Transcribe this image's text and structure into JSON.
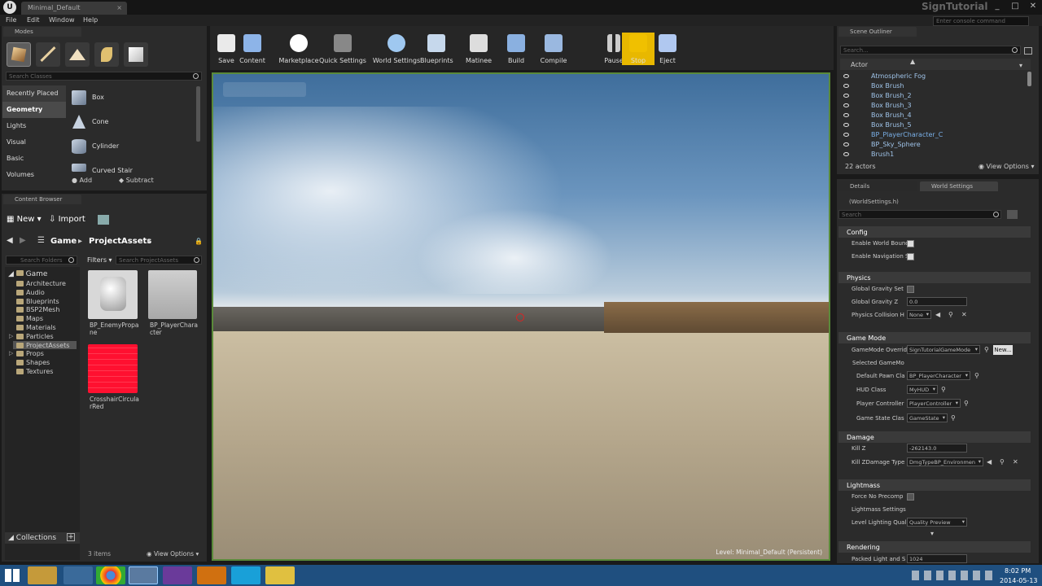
{
  "title_bar": {
    "tab": "Minimal_Default",
    "project": "SignTutorial"
  },
  "menu": [
    "File",
    "Edit",
    "Window",
    "Help"
  ],
  "console_placeholder": "Enter console command",
  "modes": {
    "tab": "Modes",
    "search_placeholder": "Search Classes",
    "categories": [
      "Recently Placed",
      "Geometry",
      "Lights",
      "Visual",
      "Basic",
      "Volumes"
    ],
    "items": [
      "Box",
      "Cone",
      "Cylinder",
      "Curved Stair"
    ],
    "add": "Add",
    "subtract": "Subtract"
  },
  "content_browser": {
    "tab": "Content Browser",
    "new": "New",
    "import": "Import",
    "path": [
      "Game",
      "ProjectAssets"
    ],
    "search_folders": "Search Folders",
    "filters": "Filters",
    "search_assets": "Search ProjectAssets",
    "tree_root": "Game",
    "tree": [
      "Architecture",
      "Audio",
      "Blueprints",
      "BSP2Mesh",
      "Maps",
      "Materials",
      "Particles",
      "ProjectAssets",
      "Props",
      "Shapes",
      "Textures"
    ],
    "assets": [
      "BP_EnemyPropane",
      "BP_PlayerCharacter",
      "CrosshairCircularRed"
    ],
    "collections": "Collections",
    "count": "3 items",
    "view_options": "View Options"
  },
  "toolbar": [
    "Save",
    "Content",
    "Marketplace",
    "Quick Settings",
    "World Settings",
    "Blueprints",
    "Matinee",
    "Build",
    "Compile",
    "Pause",
    "Stop",
    "Eject"
  ],
  "viewport": {
    "level": "Level: Minimal_Default (Persistent)"
  },
  "outliner": {
    "tab": "Scene Outliner",
    "search": "Search...",
    "column": "Actor",
    "rows": [
      "Atmospheric Fog",
      "Box Brush",
      "Box Brush_2",
      "Box Brush_3",
      "Box Brush_4",
      "Box Brush_5",
      "BP_PlayerCharacter_C",
      "BP_Sky_Sphere",
      "Brush1"
    ],
    "count": "22 actors",
    "view_options": "View Options"
  },
  "details": {
    "tab_details": "Details",
    "tab_world": "World Settings",
    "object": "(WorldSettings.h)",
    "search": "Search",
    "sections": {
      "config": {
        "title": "Config",
        "props": [
          "Enable World Bounds",
          "Enable Navigation S"
        ]
      },
      "physics": {
        "title": "Physics",
        "props": [
          "Global Gravity Set",
          "Global Gravity Z",
          "Physics Collision H"
        ],
        "gravity": "0.0",
        "collision": "None"
      },
      "gamemode": {
        "title": "Game Mode",
        "override_label": "GameMode Overrid",
        "override": "SignTutorialGameMode",
        "new": "New...",
        "selected": "Selected GameMo",
        "pawn_label": "Default Pawn Cla",
        "pawn": "BP_PlayerCharacter",
        "hud_label": "HUD Class",
        "hud": "MyHUD",
        "pc_label": "Player Controller",
        "pc": "PlayerController",
        "gs_label": "Game State Clas",
        "gs": "GameState"
      },
      "damage": {
        "title": "Damage",
        "killz_label": "Kill Z",
        "killz": "-262143.0",
        "killdmg_label": "Kill ZDamage Type",
        "killdmg": "DmgTypeBP_Environmen"
      },
      "lightmass": {
        "title": "Lightmass",
        "p1": "Force No Precomp",
        "p2": "Lightmass Settings",
        "p3": "Level Lighting Qual",
        "quality": "Quality Preview"
      },
      "rendering": {
        "title": "Rendering",
        "p1": "Packed Light and S",
        "val": "1024"
      }
    }
  },
  "taskbar": {
    "time": "8:02 PM",
    "date": "2014-05-13"
  },
  "colors": {
    "accent": "#f0c000",
    "viewport_border": "#5a8a3a",
    "taskbar": "#1f4f7f"
  }
}
